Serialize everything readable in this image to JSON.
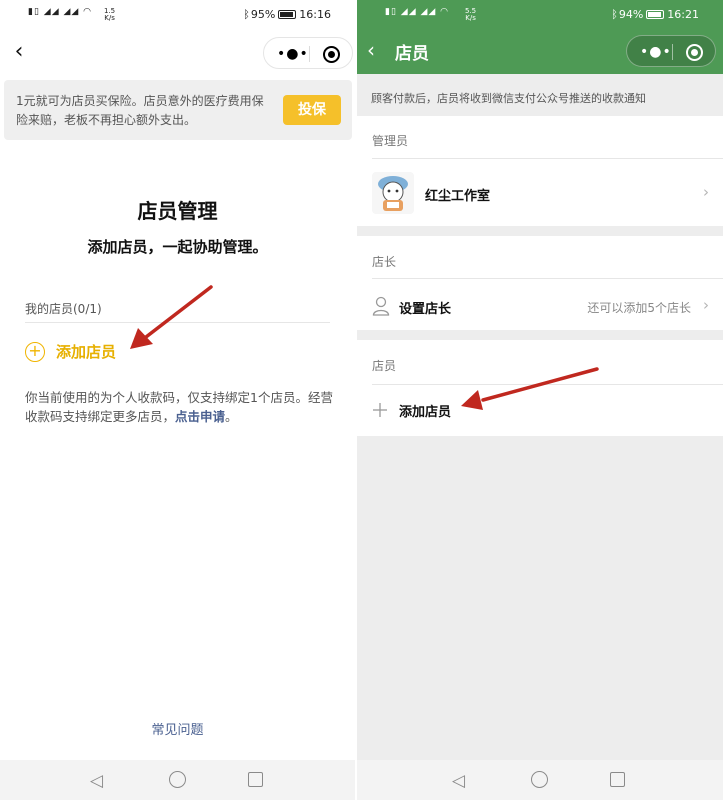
{
  "left": {
    "status": {
      "net_speed_value": "1.5",
      "net_speed_unit": "K/s",
      "battery": "95%",
      "time": "16:16"
    },
    "banner": {
      "text": "1元就可为店员买保险。店员意外的医疗费用保险来赔，老板不再担心额外支出。",
      "button_label": "投保"
    },
    "title": "店员管理",
    "subtitle": "添加店员，一起协助管理。",
    "staff_count_label": "我的店员(0/1)",
    "add_staff_label": "添加店员",
    "note_text": "你当前使用的为个人收款码，仅支持绑定1个店员。经营收款码支持绑定更多店员，",
    "note_link": "点击申请",
    "note_end": "。",
    "faq_link": "常见问题"
  },
  "right": {
    "status": {
      "net_speed_value": "5.5",
      "net_speed_unit": "K/s",
      "battery": "94%",
      "time": "16:21"
    },
    "header_title": "店员",
    "notice": "顾客付款后，店员将收到微信支付公众号推送的收款通知",
    "admin_section": {
      "title": "管理员",
      "name": "红尘工作室"
    },
    "manager_section": {
      "title": "店长",
      "action": "设置店长",
      "hint": "还可以添加5个店长"
    },
    "staff_section": {
      "title": "店员",
      "action": "添加店员"
    }
  },
  "colors": {
    "wechat_green": "#4e9a55",
    "accent_yellow": "#f5c02a",
    "link_blue": "#4a6090",
    "annotation_arrow": "#c0281f"
  }
}
